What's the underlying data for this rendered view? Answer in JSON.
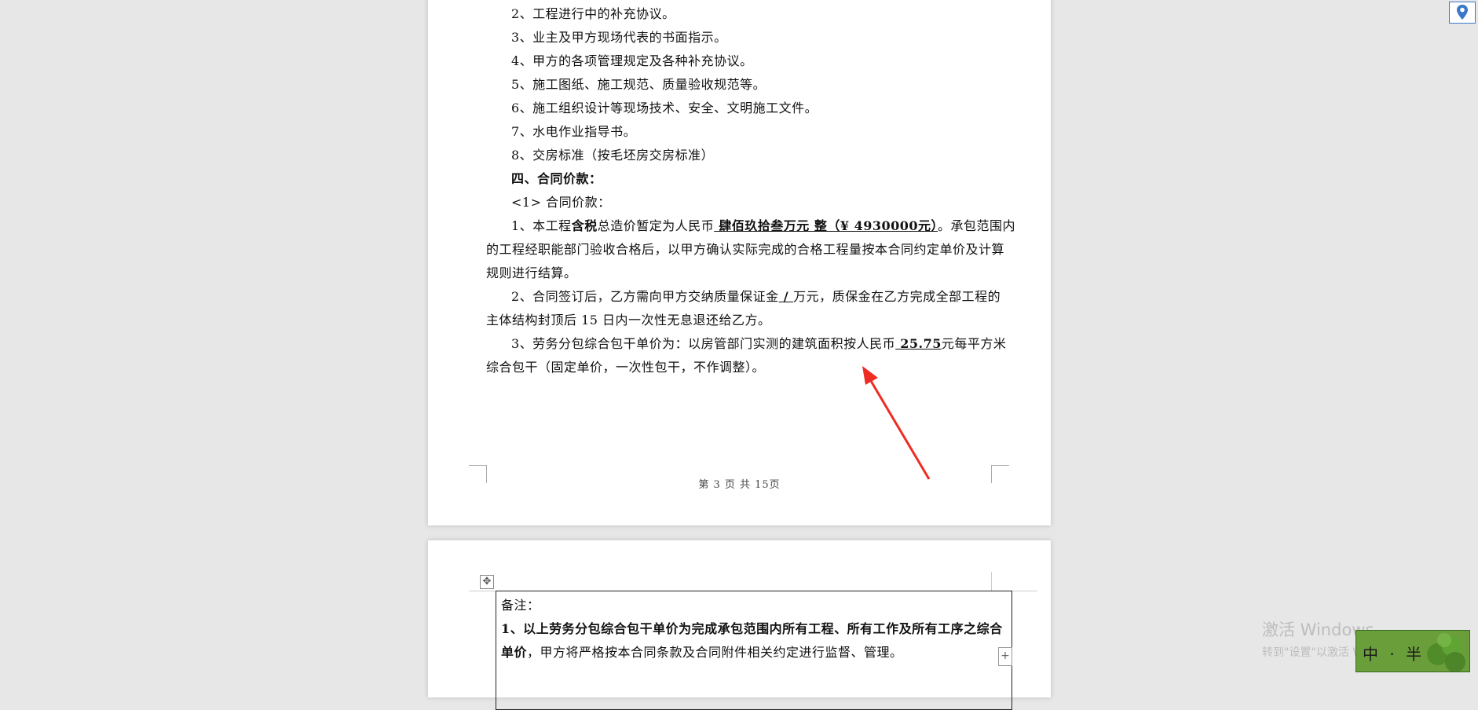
{
  "page1": {
    "lines": [
      "2、工程进行中的补充协议。",
      "3、业主及甲方现场代表的书面指示。",
      "4、甲方的各项管理规定及各种补充协议。",
      "5、施工图纸、施工规范、质量验收规范等。",
      "6、施工组织设计等现场技术、安全、文明施工文件。",
      "7、水电作业指导书。",
      "8、交房标准（按毛坯房交房标准）"
    ],
    "section_heading": "四、合同价款：",
    "sub_heading": "<1>  合同价款：",
    "item1": {
      "a": "1、本工程",
      "bold": "含税",
      "b": "总造价暂定为人民币",
      "amount": " 肆佰玖拾叁万元 整（¥ 4930000元）",
      "c": "。承包范围内",
      "line2": "的工程经职能部门验收合格后，以甲方确认实际完成的合格工程量按本合同约定单价及计算",
      "line3": "规则进行结算。"
    },
    "item2": {
      "a": "2、合同签订后，乙方需向甲方交纳质量保证金",
      "blank": " / ",
      "b": "万元，质保金在乙方完成全部工程的",
      "line2": "主体结构封顶后 15 日内一次性无息退还给乙方。"
    },
    "item3": {
      "a": "3、劳务分包综合包干单价为：以房管部门实测的建筑面积按人民币",
      "price": " 25.75",
      "b": "元每平方米",
      "line2": "综合包干（固定单价，一次性包干，不作调整）。"
    },
    "footer": "第 3 页 共 15页"
  },
  "page2": {
    "note_label": "备注：",
    "note1_bold_a": "1、以上劳务分包综合包干单价为完成承包范围内所有工程、所有工作及所有工序之综合",
    "note1_bold_b": "单价",
    "note1_rest": "，甲方将严格按本合同条款及合同附件相关约定进行监督、管理。"
  },
  "overlay": {
    "watermark_title": "激活 Windows",
    "watermark_sub": "转到\"设置\"以激活 Windows。",
    "ime_label": "中 · 半"
  },
  "colors": {
    "arrow": "#ee2c24",
    "page_bg": "#ffffff",
    "desktop_bg": "#e7e7e7"
  }
}
